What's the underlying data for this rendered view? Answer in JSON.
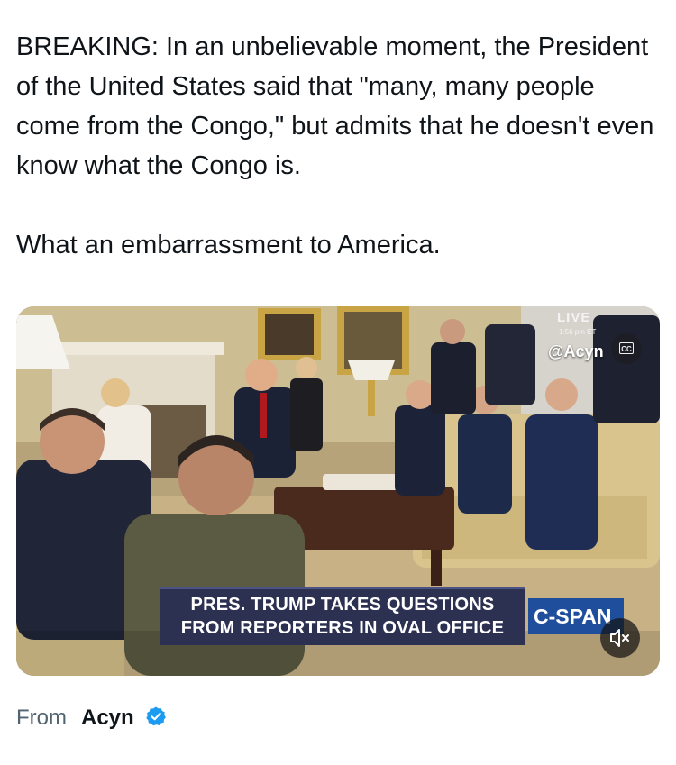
{
  "tweet": {
    "paragraphs": [
      "BREAKING: In an unbelievable moment, the President of the United States said that \"many, many people come from the Congo,\" but admits that he doesn't even know what the Congo is.",
      "What an embarrassment to America."
    ]
  },
  "video": {
    "live_label": "LIVE",
    "time_label": "1:56 pm ET",
    "handle": "@Acyn",
    "cc_label": "CC",
    "lower_third_line1": "PRES. TRUMP TAKES QUESTIONS",
    "lower_third_line2": "FROM REPORTERS IN OVAL OFFICE",
    "network": "C-SPAN",
    "muted": true,
    "icons": {
      "cc": "closed-captions-icon",
      "mute": "speaker-muted-icon"
    }
  },
  "attribution": {
    "from_label": "From",
    "author": "Acyn",
    "verified": true,
    "verified_color": "#1d9bf0"
  },
  "colors": {
    "text": "#0f1419",
    "secondary_text": "#536471",
    "lower_third_bg": "#2c3152",
    "network_bg": "#1f4f9c"
  }
}
